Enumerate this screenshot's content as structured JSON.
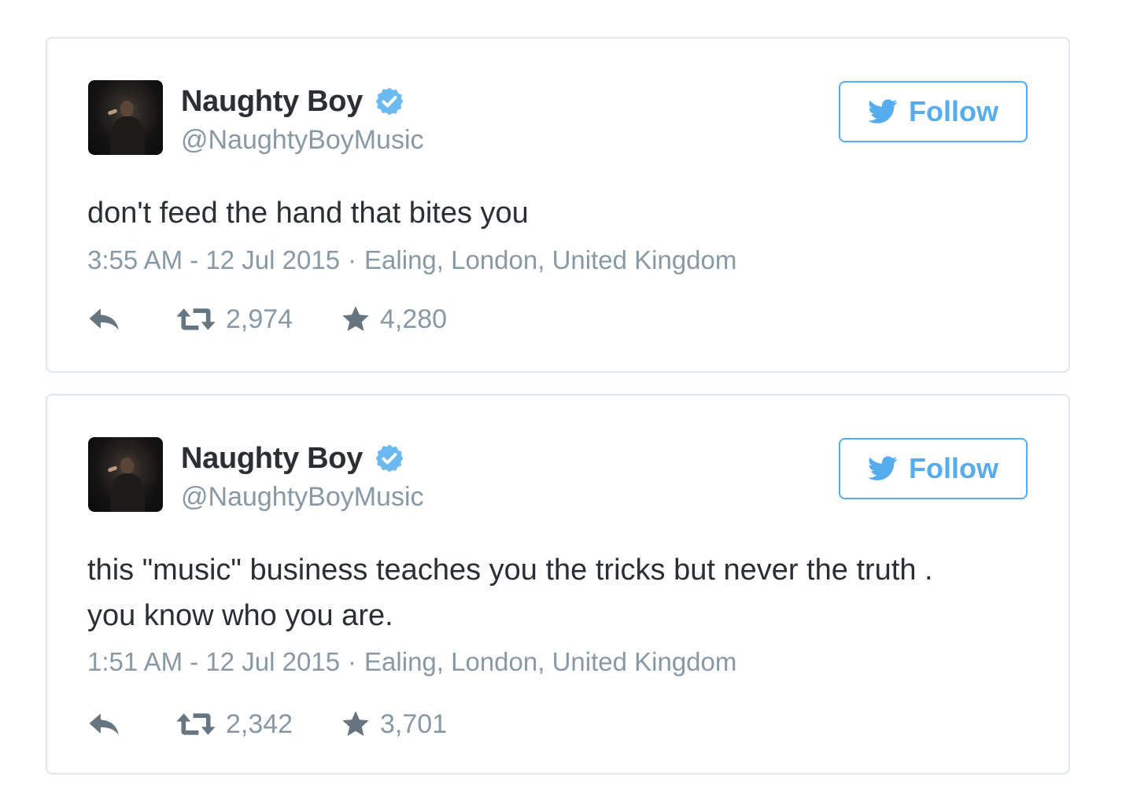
{
  "tweets": [
    {
      "display_name": "Naughty Boy",
      "handle": "@NaughtyBoyMusic",
      "verified": true,
      "follow_label": "Follow",
      "text": "don't feed the hand that bites you",
      "time": "3:55 AM - 12 Jul 2015",
      "separator": "·",
      "location": "Ealing, London, United Kingdom",
      "retweets": "2,974",
      "favorites": "4,280"
    },
    {
      "display_name": "Naughty Boy",
      "handle": "@NaughtyBoyMusic",
      "verified": true,
      "follow_label": "Follow",
      "text_lines": [
        "this \"music\" business teaches you the tricks but never the truth .",
        "you know who you are."
      ],
      "time": "1:51 AM - 12 Jul 2015",
      "separator": "·",
      "location": "Ealing, London, United Kingdom",
      "retweets": "2,342",
      "favorites": "3,701"
    }
  ],
  "icons": {
    "verified": "verified-badge-icon",
    "follow": "twitter-bird-icon",
    "reply": "reply-icon",
    "retweet": "retweet-icon",
    "favorite": "star-icon"
  },
  "colors": {
    "brand_blue": "#55acee",
    "verified_blue": "#6cb8f0",
    "text_primary": "#292f33",
    "text_secondary": "#8899a6",
    "action_gray": "#66757f",
    "border": "#e1e8ed"
  }
}
